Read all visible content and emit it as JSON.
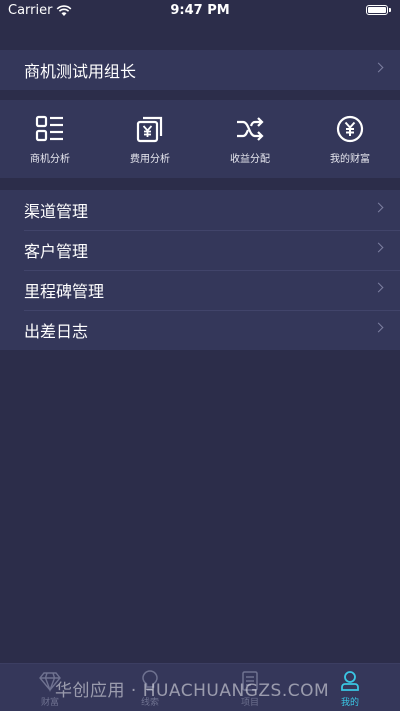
{
  "status_bar": {
    "carrier": "Carrier",
    "time": "9:47 PM",
    "battery_level": 1.0
  },
  "top_item": {
    "label": "商机测试用组长"
  },
  "shortcuts": [
    {
      "label": "商机分析",
      "icon": "list-grid-icon"
    },
    {
      "label": "费用分析",
      "icon": "yen-document-icon"
    },
    {
      "label": "收益分配",
      "icon": "shuffle-icon"
    },
    {
      "label": "我的财富",
      "icon": "yen-circle-icon"
    }
  ],
  "menu": [
    {
      "label": "渠道管理"
    },
    {
      "label": "客户管理"
    },
    {
      "label": "里程碑管理"
    },
    {
      "label": "出差日志"
    }
  ],
  "tabbar": {
    "tabs": [
      {
        "label": "财富",
        "icon": "diamond-icon",
        "active": false
      },
      {
        "label": "线索",
        "icon": "lightbulb-icon",
        "active": false
      },
      {
        "label": "项目",
        "icon": "clipboard-icon",
        "active": false
      },
      {
        "label": "我的",
        "icon": "person-icon",
        "active": true
      }
    ]
  },
  "watermark": "华创应用 · HUACHUANGZS.COM",
  "colors": {
    "background": "#2c2d4a",
    "section": "#34375a",
    "accent": "#3ac6e4"
  }
}
